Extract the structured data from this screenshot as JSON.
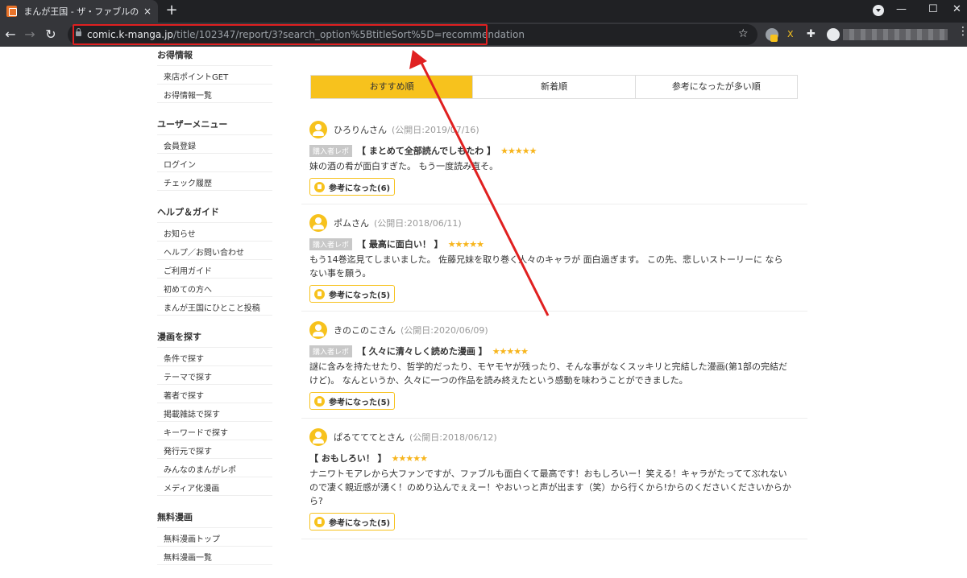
{
  "browser": {
    "tab_title": "まんが王国 - ザ・ファブルのま",
    "tab_close": "×",
    "new_tab": "+",
    "url_host": "comic.k-manga.jp",
    "url_path": "/title/102347/report/3?search_option%5BtitleSort%5D=recommendation",
    "window_controls": [
      "—",
      "☐",
      "✕"
    ],
    "back": "←",
    "forward": "→",
    "reload": "↻",
    "star": "☆",
    "ext_label": "X",
    "menu": "⋮"
  },
  "sidebar": {
    "sections": [
      {
        "heading": "お得情報",
        "items": [
          "来店ポイントGET",
          "お得情報一覧"
        ]
      },
      {
        "heading": "ユーザーメニュー",
        "items": [
          "会員登録",
          "ログイン",
          "チェック履歴"
        ]
      },
      {
        "heading": "ヘルプ＆ガイド",
        "items": [
          "お知らせ",
          "ヘルプ／お問い合わせ",
          "ご利用ガイド",
          "初めての方へ",
          "まんが王国にひとこと投稿"
        ]
      },
      {
        "heading": "漫画を探す",
        "items": [
          "条件で探す",
          "テーマで探す",
          "著者で探す",
          "掲載雑誌で探す",
          "キーワードで探す",
          "発行元で探す",
          "みんなのまんがレポ",
          "メディア化漫画"
        ]
      },
      {
        "heading": "無料漫画",
        "items": [
          "無料漫画トップ",
          "無料漫画一覧"
        ]
      }
    ]
  },
  "sort_tabs": [
    "おすすめ順",
    "新着順",
    "参考になったが多い順"
  ],
  "reviews": [
    {
      "user": "ひろりんさん",
      "date": "(公開日:2019/07/16)",
      "badge": "購入者レポ",
      "title": "【 まとめて全部読んでしもたわ 】",
      "stars": "★★★★★",
      "body": "妹の酒の肴が面白すぎた。 もう一度読み直そ。",
      "helpful": "参考になった(6)"
    },
    {
      "user": "ポムさん",
      "date": "(公開日:2018/06/11)",
      "badge": "購入者レポ",
      "title": "【 最高に面白い！ 】",
      "stars": "★★★★★",
      "body": "もう14巻迄見てしまいました。 佐藤兄妹を取り巻く人々のキャラが 面白過ぎます。 この先、悲しいストーリーに ならない事を願う。",
      "helpful": "参考になった(5)"
    },
    {
      "user": "きのこのこさん",
      "date": "(公開日:2020/06/09)",
      "badge": "購入者レポ",
      "title": "【 久々に清々しく読めた漫画 】",
      "stars": "★★★★★",
      "body": "謎に含みを持たせたり、哲学的だったり、モヤモヤが残ったり、そんな事がなくスッキリと完結した漫画(第1部の完結だけど)。 なんというか、久々に一つの作品を読み終えたという感動を味わうことができました。",
      "helpful": "参考になった(5)"
    },
    {
      "user": "ぱるてててとさん",
      "date": "(公開日:2018/06/12)",
      "badge": "",
      "title": "【 おもしろい！ 】",
      "stars": "★★★★★",
      "body": "ナニワトモアレから大ファンですが、ファブルも面白くて最高です！おもしろいー！笑える！キャラがたってて̀ぶれないので凄く親近感が湧く！のめり込んでぇえー！やおいっと声が出ます（笑）から行くから!からのくださいくださいからから?",
      "helpful": "参考になった(5)"
    }
  ]
}
